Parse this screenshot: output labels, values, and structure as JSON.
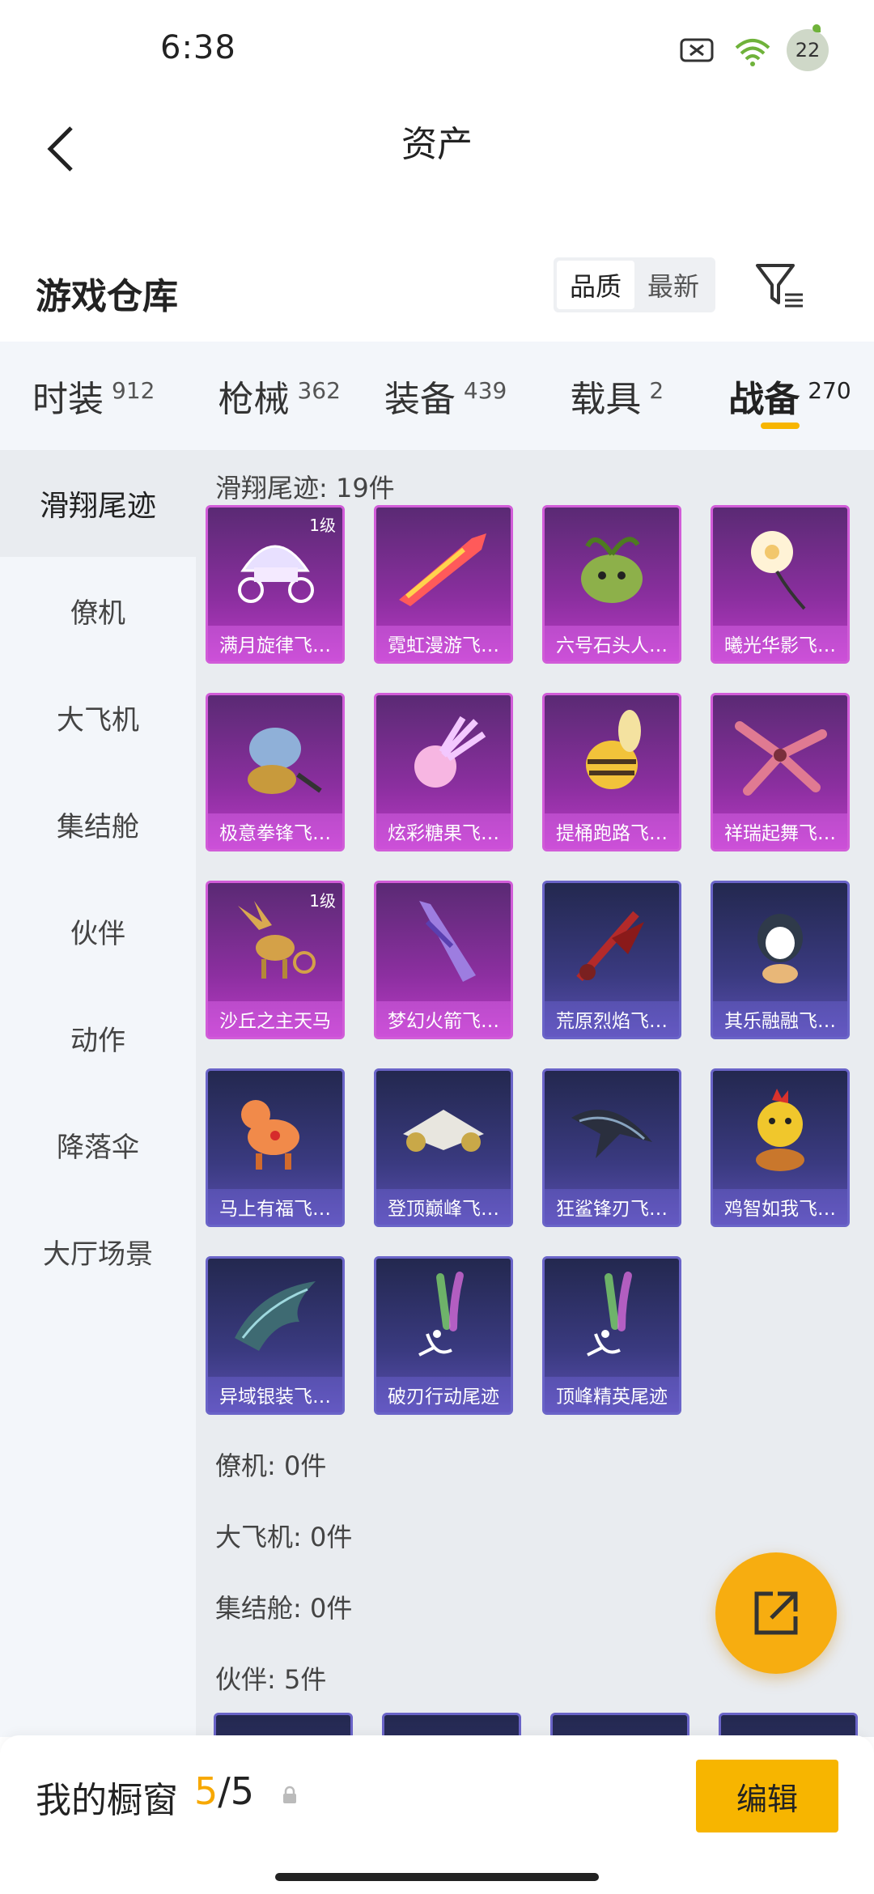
{
  "status": {
    "time": "6:38",
    "battery": "22"
  },
  "nav": {
    "title": "资产"
  },
  "warehouse": {
    "title": "游戏仓库",
    "sort_options": [
      "品质",
      "最新"
    ],
    "sort_selected": "品质"
  },
  "tabs": [
    {
      "label": "时装",
      "count": "912"
    },
    {
      "label": "枪械",
      "count": "362"
    },
    {
      "label": "装备",
      "count": "439"
    },
    {
      "label": "载具",
      "count": "2"
    },
    {
      "label": "战备",
      "count": "270",
      "active": true
    }
  ],
  "sidebar": [
    {
      "label": "滑翔尾迹",
      "active": true
    },
    {
      "label": "僚机"
    },
    {
      "label": "大飞机"
    },
    {
      "label": "集结舱"
    },
    {
      "label": "伙伴"
    },
    {
      "label": "动作"
    },
    {
      "label": "降落伞"
    },
    {
      "label": "大厅场景"
    }
  ],
  "sections": [
    {
      "title": "滑翔尾迹: 19件"
    },
    {
      "title": "僚机: 0件"
    },
    {
      "title": "大飞机: 0件"
    },
    {
      "title": "集结舱: 0件"
    },
    {
      "title": "伙伴: 5件"
    }
  ],
  "items": [
    {
      "name": "满月旋律飞…",
      "rarity": "purple",
      "level": "1级",
      "icon": "carriage-icon"
    },
    {
      "name": "霓虹漫游飞…",
      "rarity": "purple",
      "icon": "rocket-icon"
    },
    {
      "name": "六号石头人…",
      "rarity": "purple",
      "icon": "sprout-creature-icon"
    },
    {
      "name": "曦光华影飞…",
      "rarity": "purple",
      "icon": "flower-icon"
    },
    {
      "name": "极意拳锋飞…",
      "rarity": "purple",
      "icon": "elephant-icon"
    },
    {
      "name": "炫彩糖果飞…",
      "rarity": "purple",
      "icon": "candy-icon"
    },
    {
      "name": "提桶跑路飞…",
      "rarity": "purple",
      "icon": "bee-icon"
    },
    {
      "name": "祥瑞起舞飞…",
      "rarity": "purple",
      "icon": "petal-wings-icon"
    },
    {
      "name": "沙丘之主天马",
      "rarity": "purple",
      "level": "1级",
      "icon": "pegasus-icon"
    },
    {
      "name": "梦幻火箭飞…",
      "rarity": "purple",
      "icon": "glider-icon"
    },
    {
      "name": "荒原烈焰飞…",
      "rarity": "blue",
      "icon": "flame-glider-icon"
    },
    {
      "name": "其乐融融飞…",
      "rarity": "blue",
      "icon": "penguin-icon"
    },
    {
      "name": "马上有福飞…",
      "rarity": "blue",
      "icon": "pony-icon"
    },
    {
      "name": "登顶巅峰飞…",
      "rarity": "blue",
      "icon": "jet-icon"
    },
    {
      "name": "狂鲨锋刃飞…",
      "rarity": "blue",
      "icon": "shark-icon"
    },
    {
      "name": "鸡智如我飞…",
      "rarity": "blue",
      "icon": "chicken-icon"
    },
    {
      "name": "异域银装飞…",
      "rarity": "blue",
      "icon": "wing-icon"
    },
    {
      "name": "破刃行动尾迹",
      "rarity": "blue",
      "icon": "smoke-trail-icon"
    },
    {
      "name": "顶峰精英尾迹",
      "rarity": "blue",
      "icon": "smoke-trail-icon"
    }
  ],
  "showcase": {
    "label": "我的橱窗",
    "current": "5",
    "total": "5"
  },
  "edit_label": "编辑",
  "colors": {
    "accent": "#f7b500",
    "purple": "#b93bc4",
    "blue": "#5a4fb0"
  }
}
